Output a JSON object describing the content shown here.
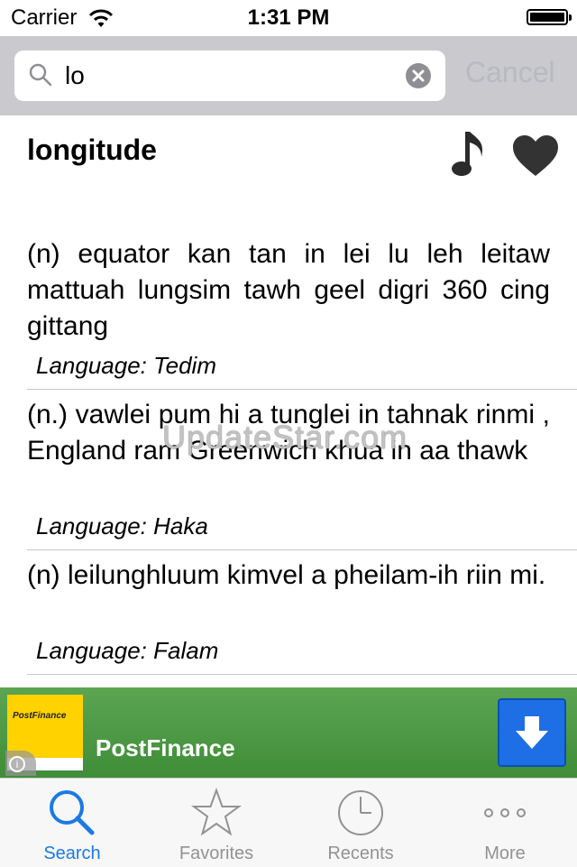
{
  "status_bar": {
    "carrier": "Carrier",
    "time": "1:31 PM"
  },
  "search": {
    "value": "lo",
    "cancel_label": "Cancel"
  },
  "entry": {
    "word": "longitude",
    "definitions": [
      {
        "text": "(n) equator kan tan in lei lu leh leitaw mattuah lungsim tawh geel digri 360 cing gittang",
        "language": "Language: Tedim"
      },
      {
        "text": "(n.) vawlei pum hi a tunglei in tahnak rinmi , England ram Greenwich khua in aa thawk",
        "language": "Language: Haka"
      },
      {
        "text": "(n) leilunghluum kimvel a pheilam-ih riin mi.",
        "language": "Language: Falam"
      }
    ]
  },
  "watermark": "UpdateStar.com",
  "ad": {
    "logo_text": "PostFinance",
    "name": "PostFinance",
    "bg_color": "#4c9a44",
    "button_color": "#1e6fe6"
  },
  "tabs": [
    {
      "label": "Search",
      "icon": "search-icon",
      "active": true
    },
    {
      "label": "Favorites",
      "icon": "star-icon"
    },
    {
      "label": "Recents",
      "icon": "clock-icon"
    },
    {
      "label": "More",
      "icon": "more-icon"
    }
  ],
  "colors": {
    "accent": "#1a7ae6",
    "tab_inactive": "#929292",
    "searchbar_bg": "#c9c9ce"
  }
}
